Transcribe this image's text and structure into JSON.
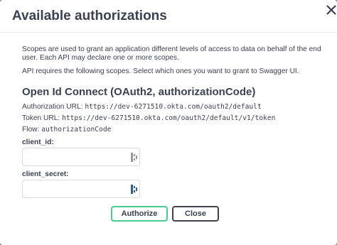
{
  "dialog": {
    "title": "Available authorizations",
    "description_1": "Scopes are used to grant an application different levels of access to data on behalf of the end user. Each API may declare one or more scopes.",
    "description_2": "API requires the following scopes. Select which ones you want to grant to Swagger UI."
  },
  "scheme": {
    "name": "Open Id Connect (OAuth2, authorizationCode)",
    "authorization_url_label": "Authorization URL:",
    "authorization_url": "https://dev-6271510.okta.com/oauth2/default",
    "token_url_label": "Token URL:",
    "token_url": "https://dev-6271510.okta.com/oauth2/default/v1/token",
    "flow_label": "Flow:",
    "flow": "authorizationCode"
  },
  "fields": {
    "client_id_label": "client_id:",
    "client_id_value": "",
    "client_secret_label": "client_secret:",
    "client_secret_value": ""
  },
  "buttons": {
    "authorize": "Authorize",
    "close": "Close"
  },
  "colors": {
    "authorize_border": "#49cc90",
    "text": "#3b4151"
  }
}
